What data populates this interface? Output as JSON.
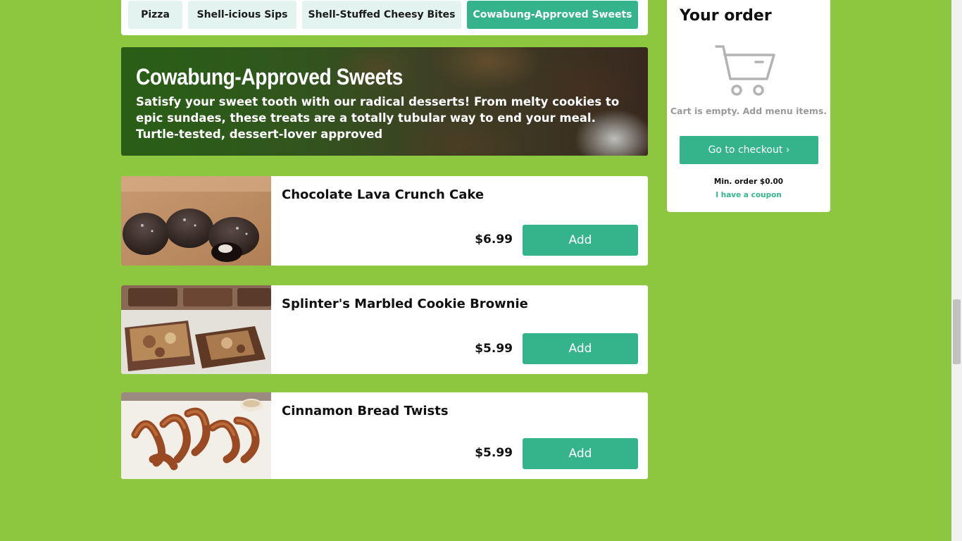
{
  "tabs": [
    {
      "label": "Pizza",
      "active": false
    },
    {
      "label": "Shell-icious Sips",
      "active": false
    },
    {
      "label": "Shell-Stuffed Cheesy Bites",
      "active": false
    },
    {
      "label": "Cowabung-Approved Sweets",
      "active": true
    }
  ],
  "banner": {
    "title": "Cowabung-Approved Sweets",
    "description": "Satisfy your sweet tooth with our radical desserts! From melty cookies to epic sundaes, these treats are a totally tubular way to end your meal. Turtle-tested, dessert-lover approved"
  },
  "items": [
    {
      "name": "Chocolate Lava Crunch Cake",
      "price": "$6.99",
      "add_label": "Add"
    },
    {
      "name": "Splinter's Marbled Cookie Brownie",
      "price": "$5.99",
      "add_label": "Add"
    },
    {
      "name": "Cinnamon Bread Twists",
      "price": "$5.99",
      "add_label": "Add"
    }
  ],
  "order": {
    "title": "Your order",
    "empty_message": "Cart is empty. Add menu items.",
    "checkout_label": "Go to checkout ›",
    "min_order": "Min. order $0.00",
    "coupon_link": "I have a coupon"
  },
  "colors": {
    "page_background": "#8dc63f",
    "accent": "#35b48b",
    "tab_inactive": "#e3f3ef"
  },
  "icons": {
    "cart": "cart-icon"
  }
}
